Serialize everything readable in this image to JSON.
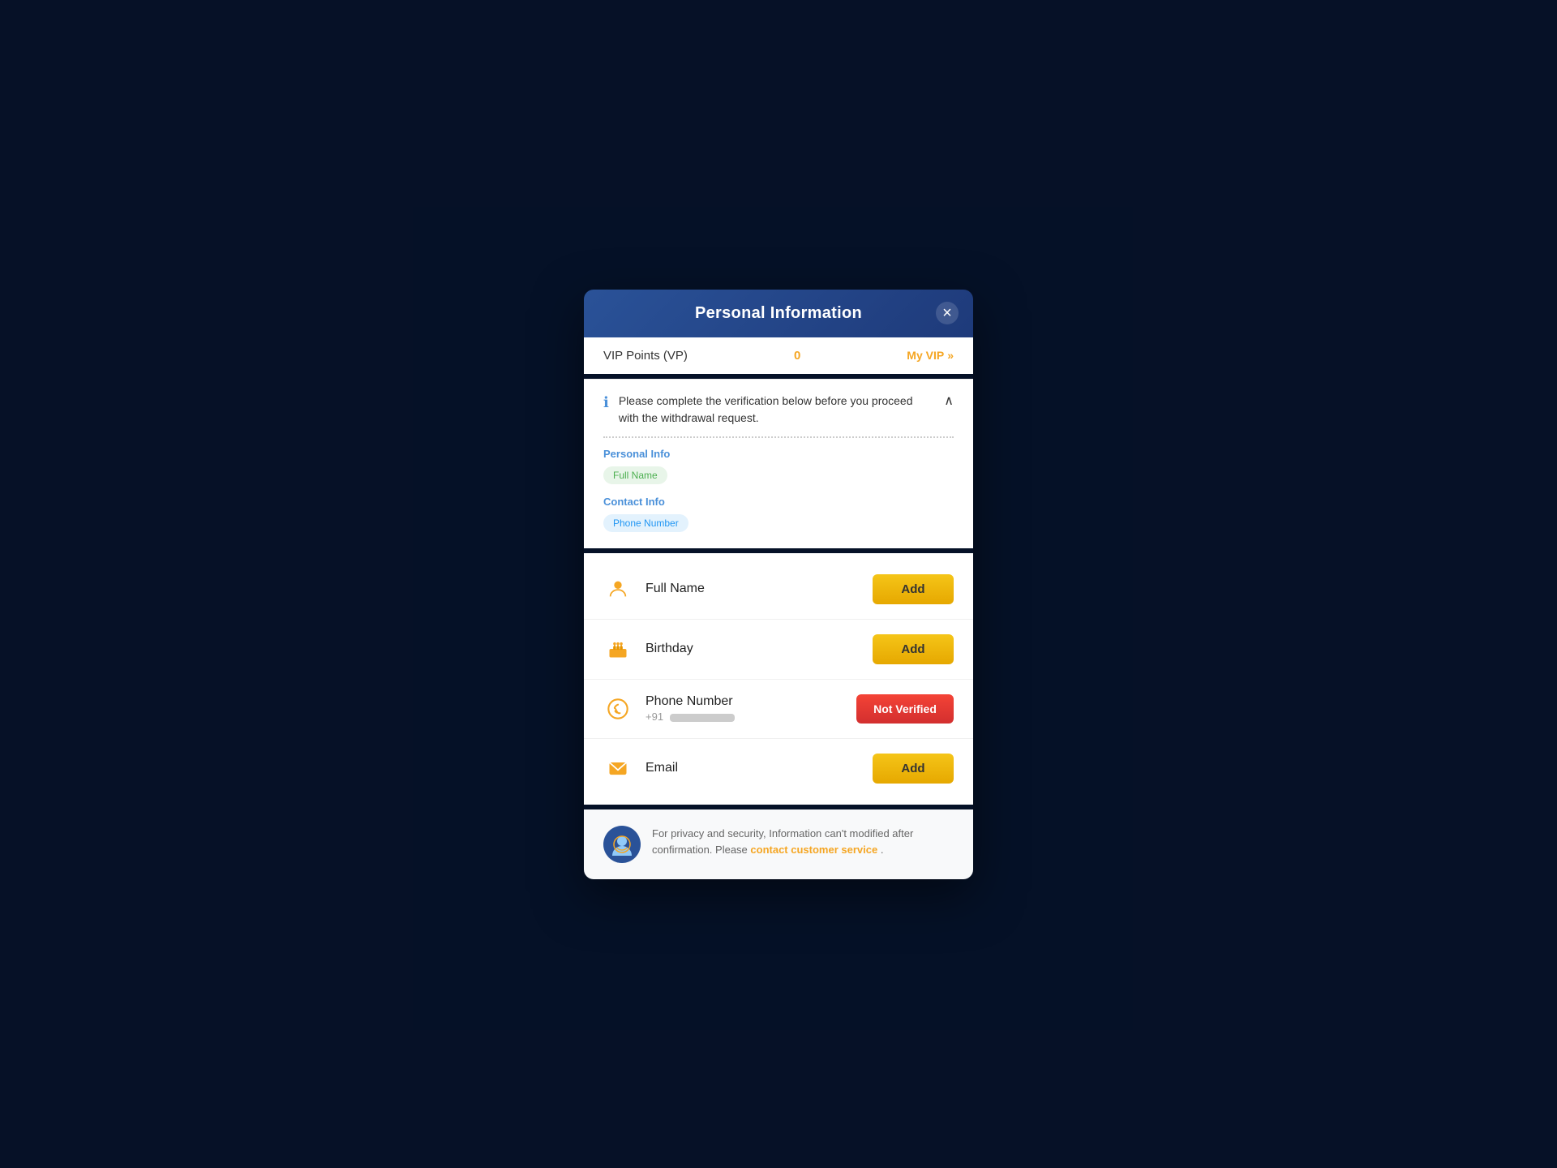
{
  "modal": {
    "title": "Personal Information",
    "close_label": "×"
  },
  "vip": {
    "label": "VIP Points (VP)",
    "points": "0",
    "my_vip_label": "My VIP",
    "chevron": "»"
  },
  "verification": {
    "message": "Please complete the verification below before you proceed with the withdrawal request.",
    "chevron": "∧",
    "personal_info_label": "Personal Info",
    "contact_info_label": "Contact Info",
    "badges": {
      "full_name": "Full Name",
      "phone_number": "Phone Number"
    }
  },
  "fields": [
    {
      "name": "Full Name",
      "icon": "person",
      "sub": null,
      "action": "add",
      "status": "add"
    },
    {
      "name": "Birthday",
      "icon": "cake",
      "sub": null,
      "action": "add",
      "status": "add"
    },
    {
      "name": "Phone Number",
      "icon": "phone",
      "sub": "+91",
      "masked": true,
      "action": "not_verified",
      "status": "not_verified"
    },
    {
      "name": "Email",
      "icon": "email",
      "sub": null,
      "action": "add",
      "status": "add"
    }
  ],
  "buttons": {
    "add_label": "Add",
    "not_verified_label": "Not Verified"
  },
  "footer": {
    "text": "For privacy and security, Information can't modified after confirmation. Please",
    "link_text": "contact customer service",
    "period": "."
  }
}
